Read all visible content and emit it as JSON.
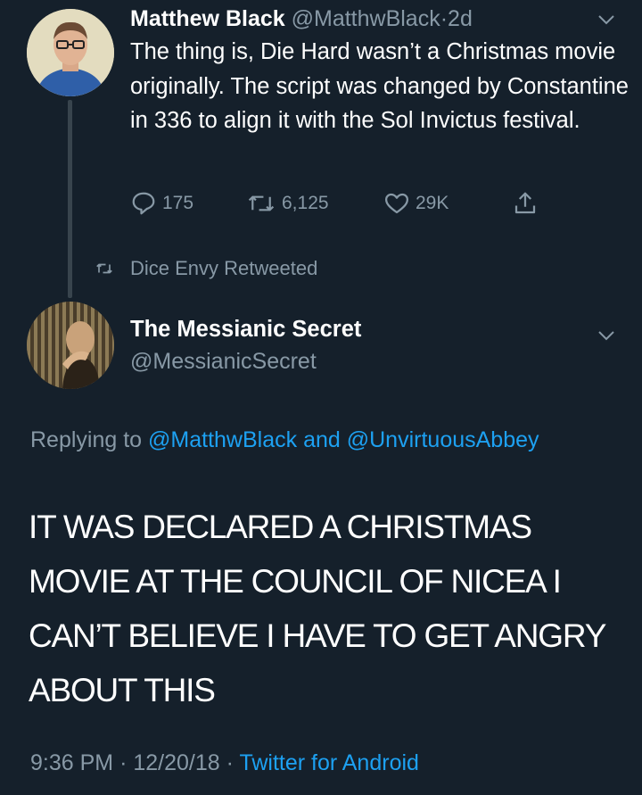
{
  "tweet1": {
    "name": "Matthew Black",
    "handle": "@MatthwBlack",
    "separator": "·",
    "time": "2d",
    "text": "The thing is, Die Hard wasn’t a Christmas movie originally. The script was changed by Constantine in 336 to align it with the Sol Invictus festival.",
    "replies": "175",
    "retweets": "6,125",
    "likes": "29K",
    "icons": [
      "reply-icon",
      "retweet-icon",
      "like-icon",
      "share-icon",
      "chevron-down-icon"
    ]
  },
  "retweet_notice": "Dice Envy Retweeted",
  "tweet2": {
    "name": "The Messianic Secret",
    "handle": "@MessianicSecret",
    "replying_prefix": "Replying to",
    "replying_user1": "@MatthwBlack",
    "replying_and": "and",
    "replying_user2": "@UnvirtuousAbbey",
    "text": "IT WAS DECLARED A CHRISTMAS MOVIE AT THE COUNCIL OF NICEA I CAN’T BELIEVE I HAVE TO GET ANGRY ABOUT THIS",
    "time": "9:36 PM",
    "date": "12/20/18",
    "dot": "·",
    "source": "Twitter for Android"
  },
  "colors": {
    "background": "#15202b",
    "text": "#ffffff",
    "muted": "#8899a6",
    "link": "#1da1f2"
  }
}
